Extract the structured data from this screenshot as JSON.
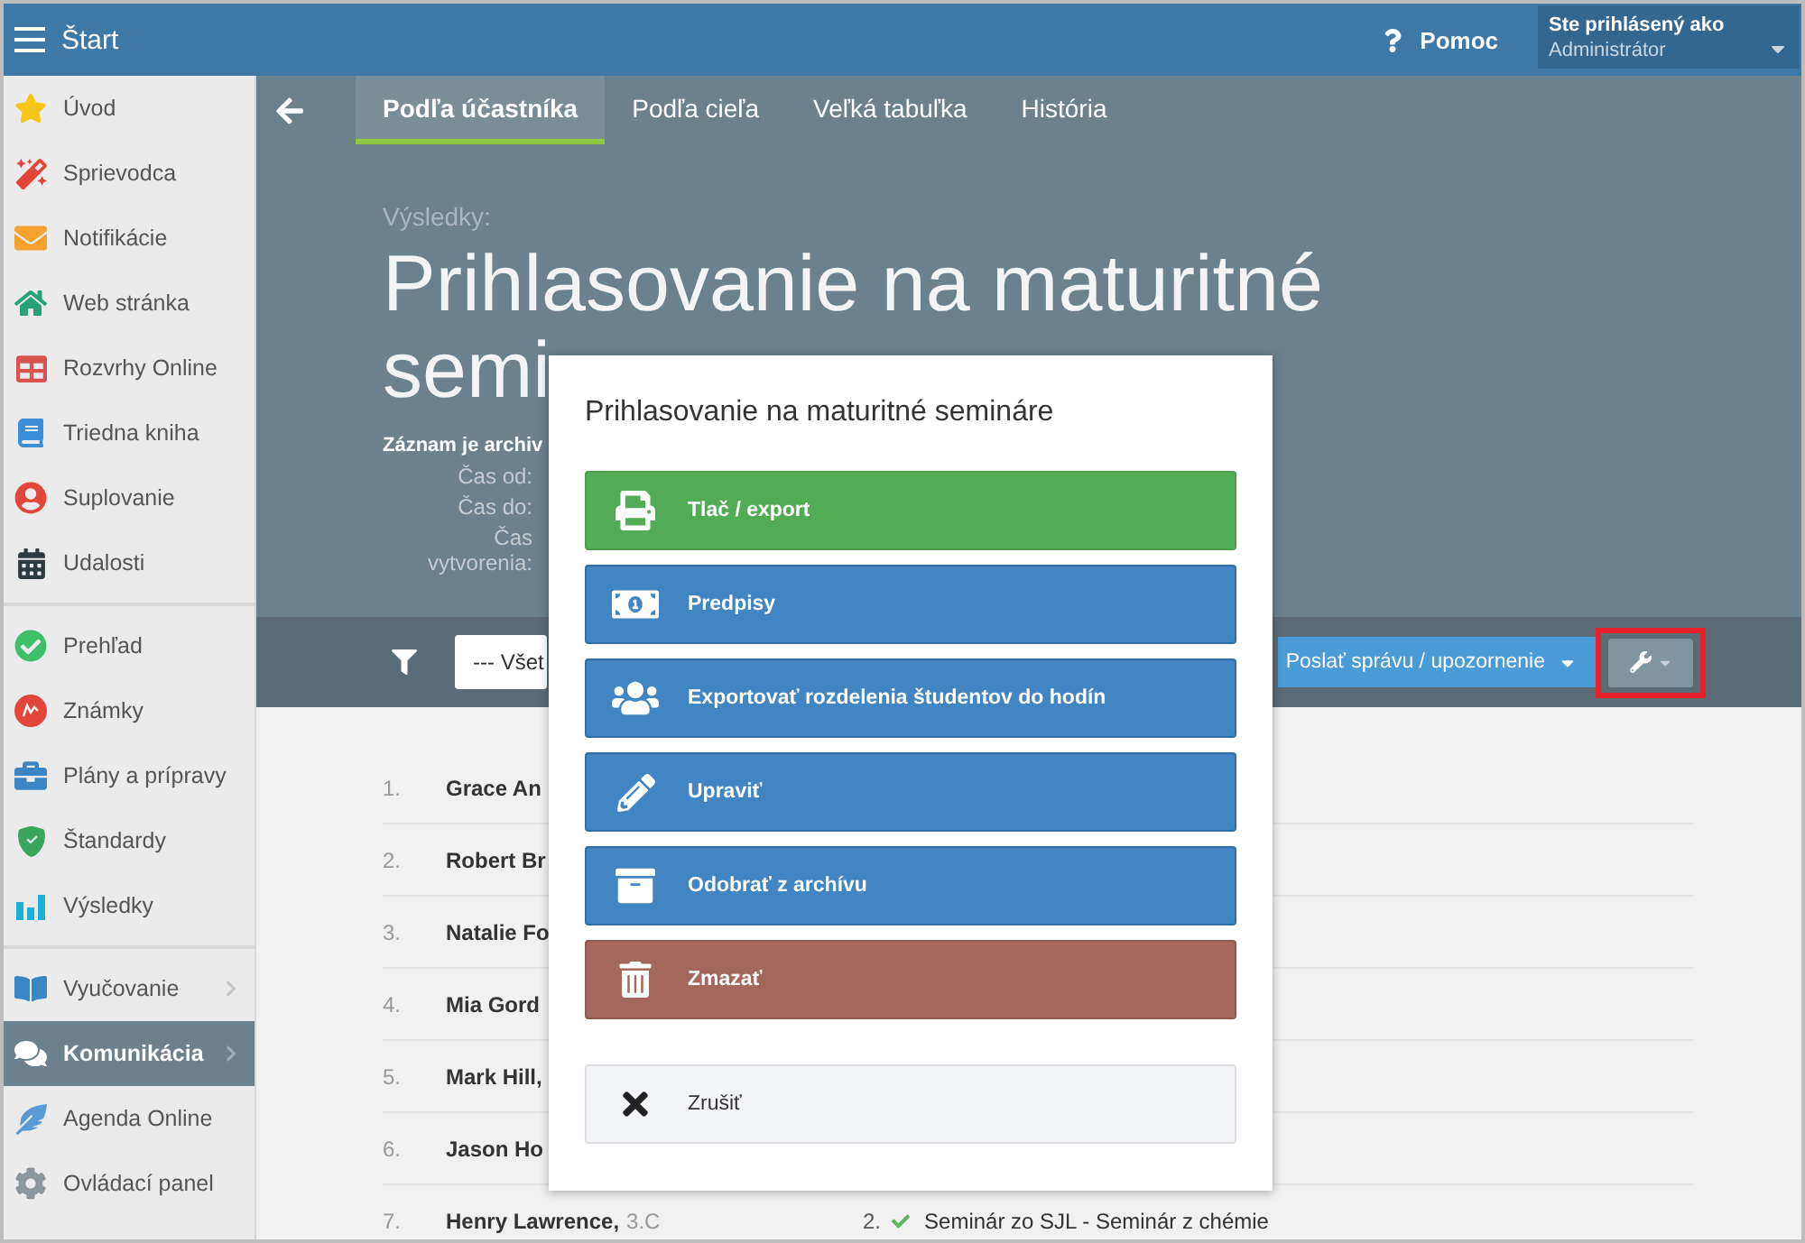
{
  "header": {
    "title": "Štart",
    "help": "Pomoc",
    "user": {
      "caption": "Ste prihlásený ako",
      "name": "Administrátor"
    }
  },
  "sidebar": {
    "sections": [
      {
        "items": [
          {
            "label": "Úvod",
            "selected": false,
            "has_submenu": false
          },
          {
            "label": "Sprievodca",
            "selected": false,
            "has_submenu": false
          },
          {
            "label": "Notifikácie",
            "selected": false,
            "has_submenu": false
          },
          {
            "label": "Web stránka",
            "selected": false,
            "has_submenu": false
          },
          {
            "label": "Rozvrhy Online",
            "selected": false,
            "has_submenu": false
          },
          {
            "label": "Triedna kniha",
            "selected": false,
            "has_submenu": false
          },
          {
            "label": "Suplovanie",
            "selected": false,
            "has_submenu": false
          },
          {
            "label": "Udalosti",
            "selected": false,
            "has_submenu": false
          }
        ]
      },
      {
        "items": [
          {
            "label": "Prehľad",
            "selected": false,
            "has_submenu": false
          },
          {
            "label": "Známky",
            "selected": false,
            "has_submenu": false
          },
          {
            "label": "Plány a prípravy",
            "selected": false,
            "has_submenu": false
          },
          {
            "label": "Štandardy",
            "selected": false,
            "has_submenu": false
          },
          {
            "label": "Výsledky",
            "selected": false,
            "has_submenu": false
          }
        ]
      },
      {
        "items": [
          {
            "label": "Vyučovanie",
            "selected": false,
            "has_submenu": true
          },
          {
            "label": "Komunikácia",
            "selected": true,
            "has_submenu": true
          },
          {
            "label": "Agenda Online",
            "selected": false,
            "has_submenu": false
          },
          {
            "label": "Ovládací panel",
            "selected": false,
            "has_submenu": false
          }
        ]
      }
    ]
  },
  "tabs": [
    {
      "label": "Podľa účastníka",
      "selected": true
    },
    {
      "label": "Podľa cieľa",
      "selected": false
    },
    {
      "label": "Veľká tabuľka",
      "selected": false
    },
    {
      "label": "História",
      "selected": false
    }
  ],
  "page": {
    "overline": "Výsledky:",
    "title_lines": [
      "Prihlasovanie na maturitné",
      "semi"
    ],
    "archived_note": "Záznam je archiv",
    "fields": [
      {
        "label": "Čas od:"
      },
      {
        "label": "Čas do:"
      },
      {
        "label": "Čas vytvorenia:"
      }
    ]
  },
  "toolbar": {
    "filter": {
      "value": "--- Všet"
    },
    "send_button": "Poslať správu / upozornenie",
    "tools_highlighted": true
  },
  "rows": [
    {
      "number": "1.",
      "name": "Grace An"
    },
    {
      "number": "2.",
      "name": "Robert Br"
    },
    {
      "number": "3.",
      "name": "Natalie Fo"
    },
    {
      "number": "4.",
      "name": "Mia Gord"
    },
    {
      "number": "5.",
      "name": "Mark Hill,"
    },
    {
      "number": "6.",
      "name": "Jason Ho"
    },
    {
      "number": "7.",
      "name": "Henry Lawrence,",
      "class": "3.C",
      "count": "2.",
      "target": "Seminár zo SJL - Seminár z chémie"
    }
  ],
  "dialog": {
    "title": "Prihlasovanie na maturitné semináre",
    "actions": [
      {
        "kind": "print",
        "label": "Tlač / export"
      },
      {
        "kind": "money",
        "label": "Predpisy"
      },
      {
        "kind": "users",
        "label": "Exportovať rozdelenia študentov do hodín"
      },
      {
        "kind": "edit",
        "label": "Upraviť"
      },
      {
        "kind": "archive",
        "label": "Odobrať z archívu"
      },
      {
        "kind": "delete",
        "label": "Zmazať"
      },
      {
        "kind": "cancel",
        "label": "Zrušiť"
      }
    ]
  }
}
